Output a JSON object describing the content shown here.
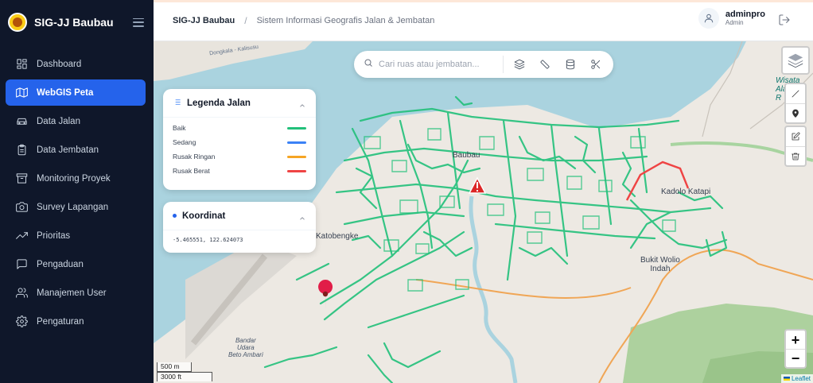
{
  "app": {
    "title": "SIG-JJ Baubau"
  },
  "sidebar": {
    "items": [
      {
        "label": "Dashboard",
        "icon": "dashboard-icon",
        "active": false
      },
      {
        "label": "WebGIS Peta",
        "icon": "map-icon",
        "active": true
      },
      {
        "label": "Data Jalan",
        "icon": "car-icon",
        "active": false
      },
      {
        "label": "Data Jembatan",
        "icon": "clipboard-icon",
        "active": false
      },
      {
        "label": "Monitoring Proyek",
        "icon": "archive-icon",
        "active": false
      },
      {
        "label": "Survey Lapangan",
        "icon": "camera-icon",
        "active": false
      },
      {
        "label": "Prioritas",
        "icon": "trending-up-icon",
        "active": false
      },
      {
        "label": "Pengaduan",
        "icon": "message-icon",
        "active": false
      },
      {
        "label": "Manajemen User",
        "icon": "users-icon",
        "active": false
      },
      {
        "label": "Pengaturan",
        "icon": "gear-icon",
        "active": false
      }
    ]
  },
  "header": {
    "breadcrumb_root": "SIG-JJ Baubau",
    "breadcrumb_sep": "/",
    "breadcrumb_sub": "Sistem Informasi Geografis Jalan & Jembatan",
    "user_name": "adminpro",
    "user_role": "Admin"
  },
  "search": {
    "placeholder": "Cari ruas atau jembatan..."
  },
  "legend": {
    "title": "Legenda Jalan",
    "items": [
      {
        "label": "Baik",
        "color": "#22c07a"
      },
      {
        "label": "Sedang",
        "color": "#3b82f6"
      },
      {
        "label": "Rusak Ringan",
        "color": "#f5a524"
      },
      {
        "label": "Rusak Berat",
        "color": "#ef4444"
      }
    ]
  },
  "coordinates": {
    "title": "Koordinat",
    "value": "-5.465551, 122.624073"
  },
  "map": {
    "labels": {
      "baubau": "Baubau",
      "katobengke": "Katobengke",
      "kadolokatapi": "Kadolo Katapi",
      "bukitwolio1": "Bukit Wolio",
      "bukitwolio2": "Indah",
      "bandara1": "Bandar",
      "bandara2": "Udara",
      "bandara3": "Beto Ambari",
      "wisata1": "Wisata",
      "wisata2": "Alam",
      "wisata3": "R",
      "dongkala": "Dongkala - Kalisusu"
    },
    "zoom_in": "+",
    "zoom_out": "−",
    "scale_metric": "500 m",
    "scale_imperial": "3000 ft",
    "attribution": "Leaflet",
    "colors": {
      "sea": "#aad3df",
      "land": "#ede9e3",
      "forest": "#add19e",
      "road_good": "#22c07a",
      "road_bad": "#ef4444",
      "river": "#aad3df"
    }
  }
}
